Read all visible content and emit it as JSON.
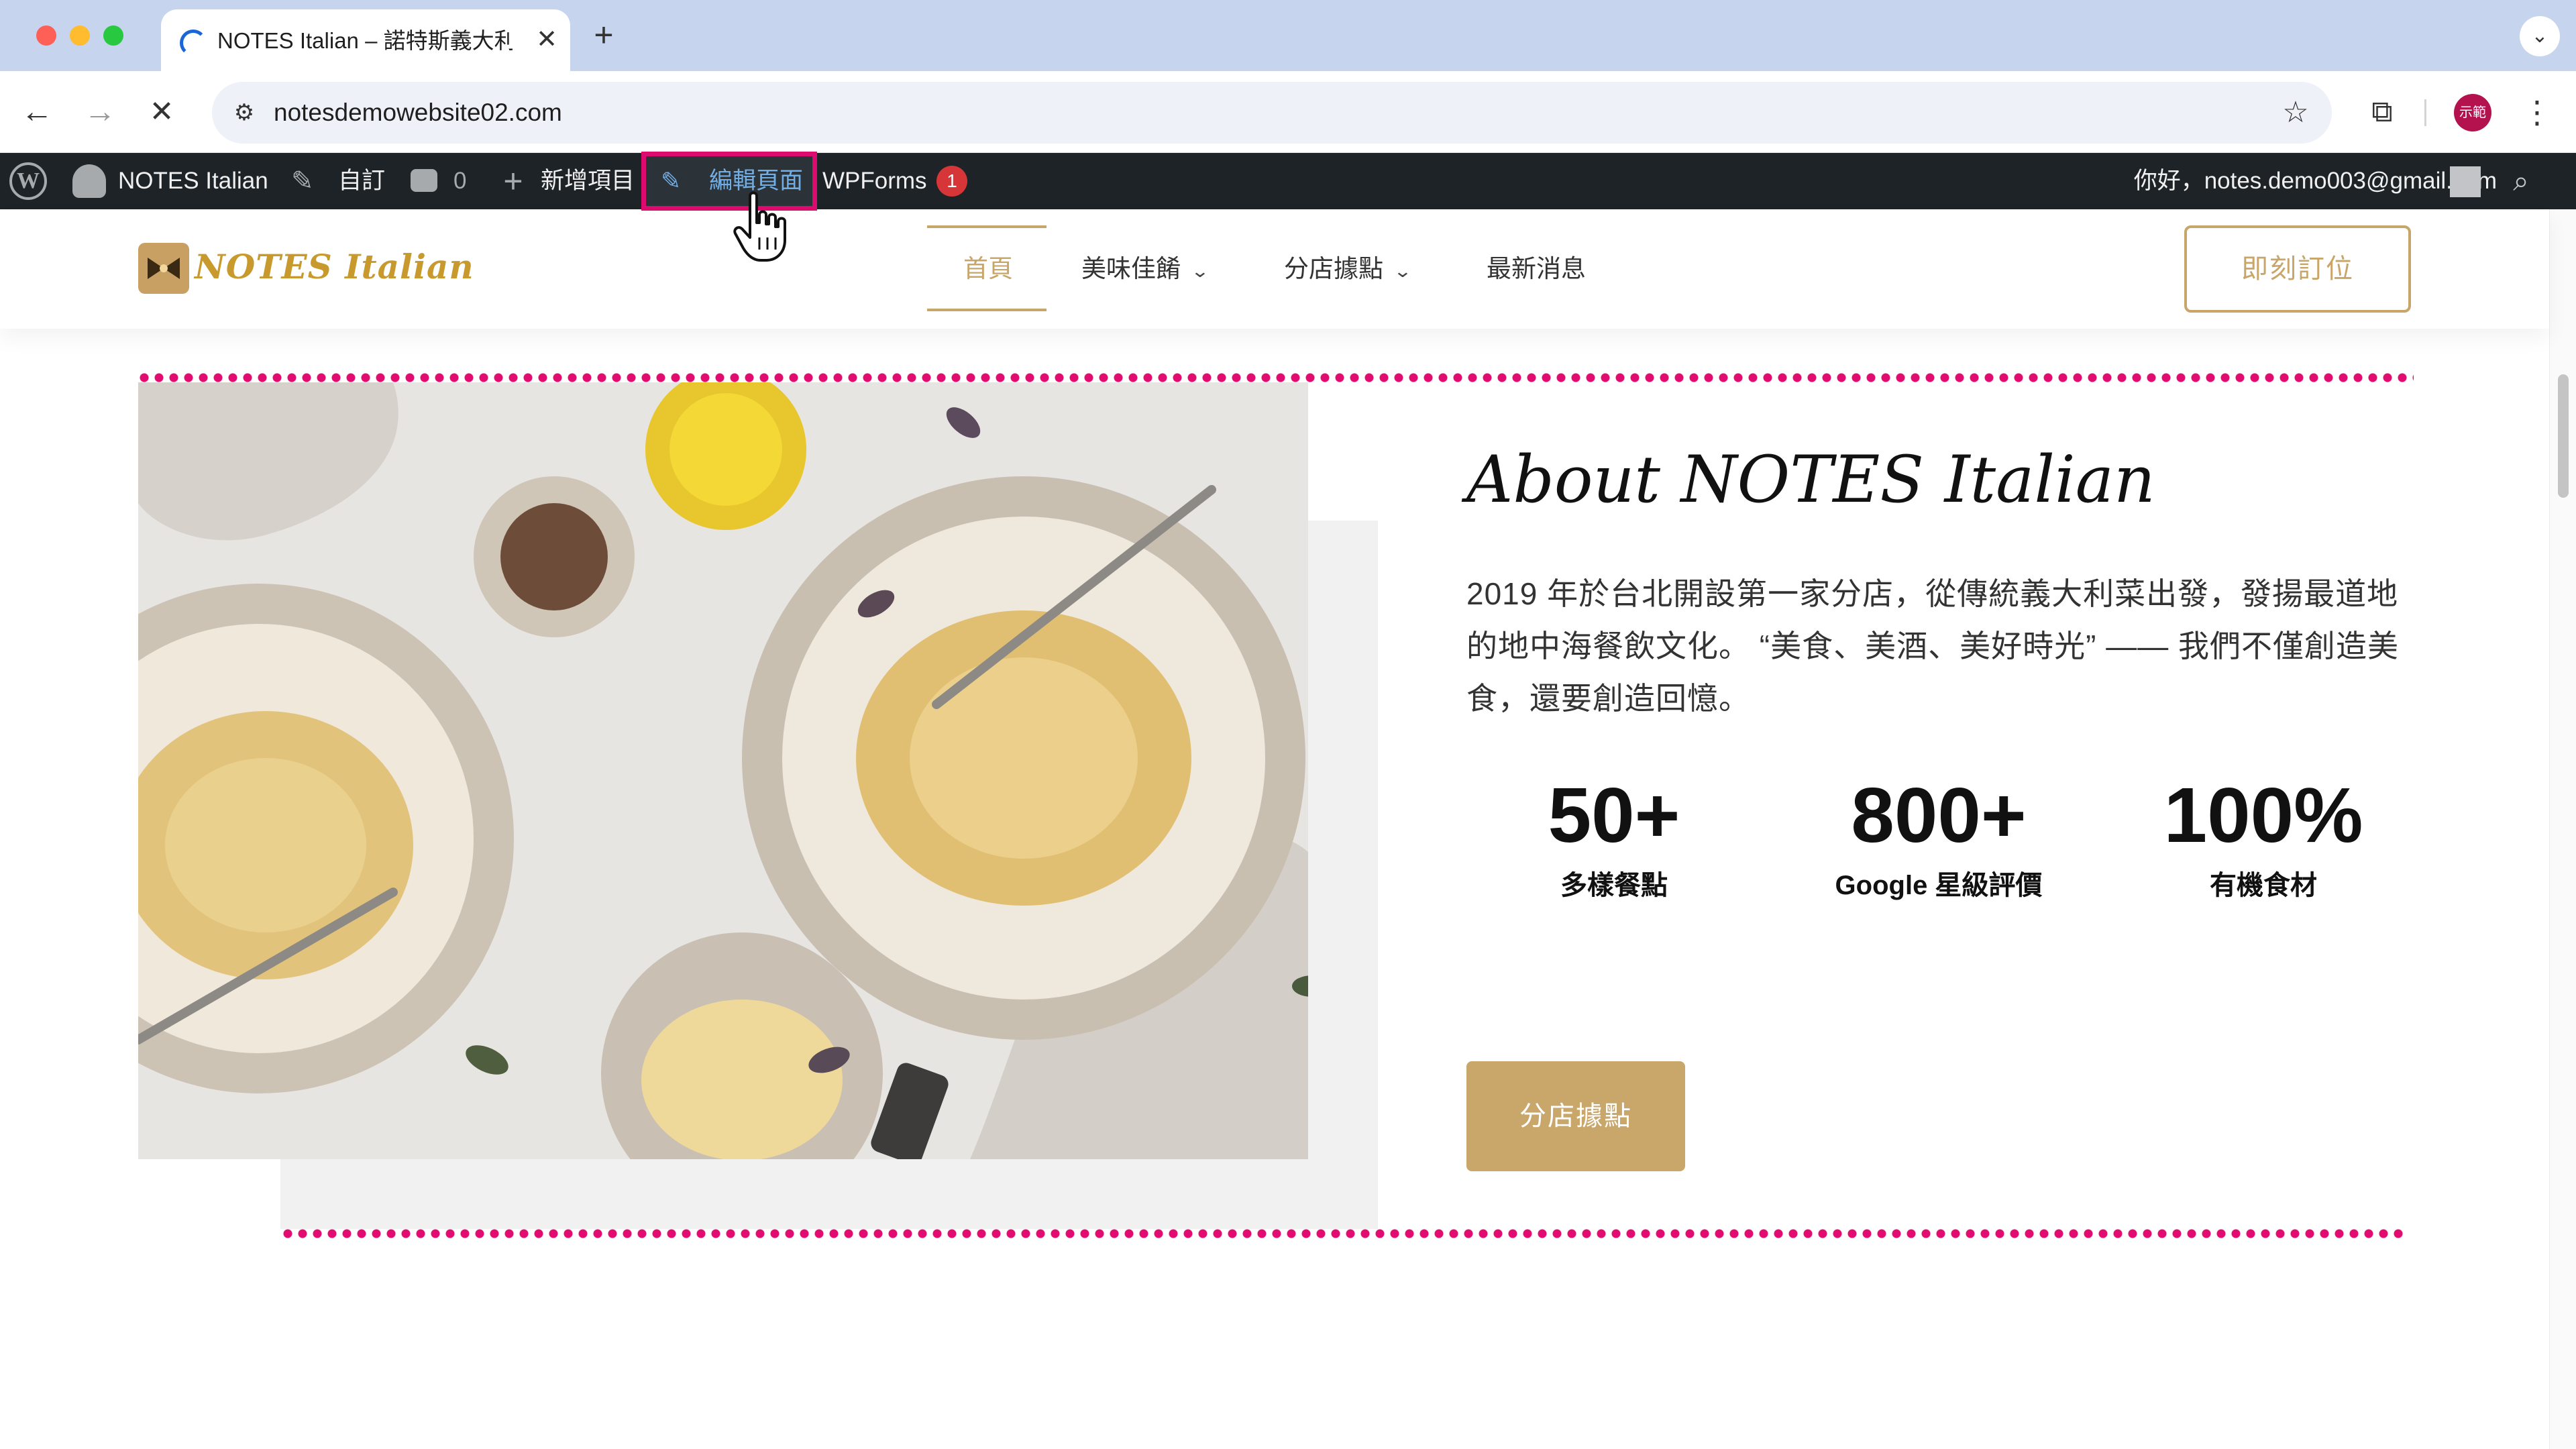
{
  "browser": {
    "tab_title": "NOTES Italian – 諾特斯義大利",
    "tab_close": "✕",
    "new_tab": "+",
    "tab_menu": "⌄",
    "url": "notesdemowebsite02.com",
    "avatar_label": "示範"
  },
  "admin_bar": {
    "site_name": "NOTES Italian",
    "customize": "自訂",
    "comments_count": "0",
    "new_item": "新增項目",
    "edit_page": "編輯頁面",
    "wpforms": "WPForms",
    "wpforms_badge": "1",
    "greeting": "你好，notes.demo003@gmail.com"
  },
  "site": {
    "logo_text": "NOTES Italian",
    "nav": {
      "home": "首頁",
      "menu": "美味佳餚",
      "branches": "分店據點",
      "news": "最新消息"
    },
    "cta": "即刻訂位"
  },
  "about": {
    "title": "About NOTES Italian",
    "text": "2019 年於台北開設第一家分店，從傳統義大利菜出發，發揚最道地的地中海餐飲文化。 “美食、美酒、美好時光” —— 我們不僅創造美食，還要創造回憶。",
    "stats": [
      {
        "value": "50+",
        "label": "多樣餐點"
      },
      {
        "value": "800+",
        "label": "Google 星級評價"
      },
      {
        "value": "100%",
        "label": "有機食材"
      }
    ],
    "button": "分店據點"
  },
  "colors": {
    "accent_gold": "#c8a66a",
    "dot_pink": "#e20b6f",
    "highlight_border": "#de0b6e",
    "admin_bar": "#1d2327",
    "tabstrip": "#c6d4ee"
  },
  "icons": [
    "wordpress-icon",
    "dashboard-icon",
    "brush-icon",
    "comment-icon",
    "plus-icon",
    "pencil-icon",
    "user-icon",
    "search-icon",
    "star-icon",
    "extensions-icon",
    "site-info-icon"
  ]
}
